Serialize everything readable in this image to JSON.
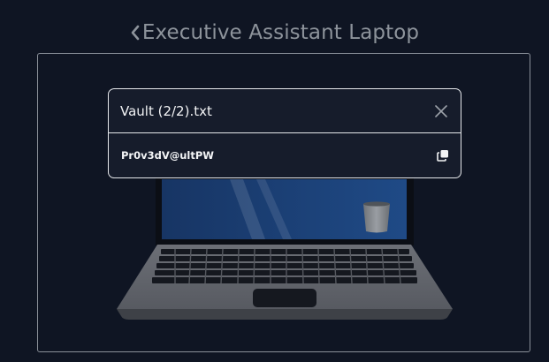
{
  "header": {
    "title": "Executive Assistant Laptop",
    "back_icon": "chevron-left-icon"
  },
  "laptop": {
    "screen_color": "#1c3f72",
    "body_color": "#5e6168",
    "keyboard_color": "#15181f",
    "trash_icon": "trash-bin-icon"
  },
  "modal": {
    "title": "Vault (2/2).txt",
    "close_icon": "close-icon",
    "password": "Pr0v3dV@ultPW",
    "copy_icon": "copy-icon"
  },
  "colors": {
    "background": "#0f1523",
    "modal_background": "#161c2b",
    "border": "#e6e8eb",
    "title_text": "#8d939b"
  }
}
